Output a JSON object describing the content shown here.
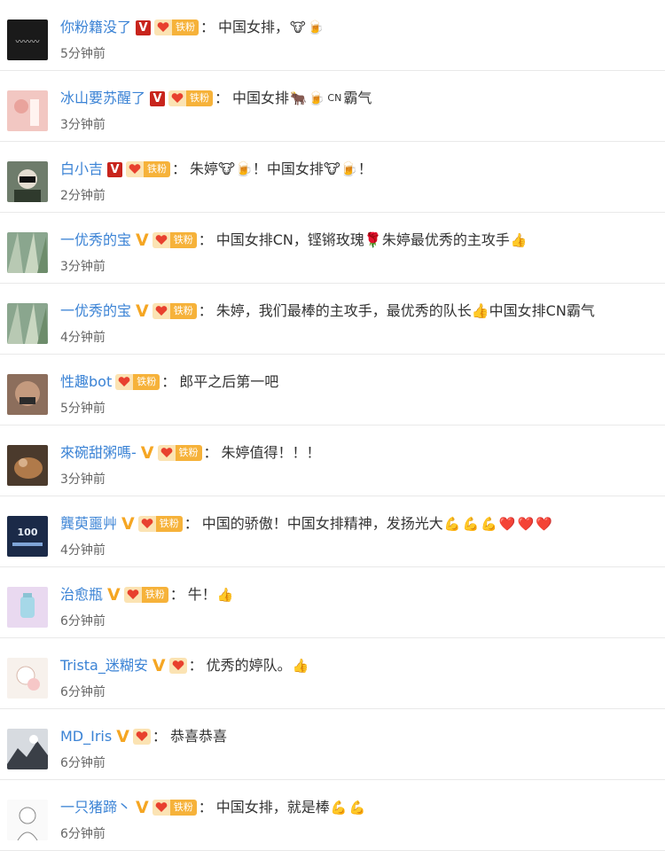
{
  "comments": [
    {
      "user": "你粉籍没了",
      "badge": "red",
      "fan": "铁粉",
      "text": "中国女排，",
      "emojis": [
        "🐮",
        "🍺"
      ],
      "time": "5分钟前"
    },
    {
      "user": "冰山要苏醒了",
      "badge": "red",
      "fan": "铁粉",
      "text": "中国女排",
      "emojis": [
        "🐂",
        "🍺"
      ],
      "suffix_small": "CN",
      "suffix": "霸气",
      "time": "3分钟前"
    },
    {
      "user": "白小吉",
      "badge": "red",
      "fan": "铁粉",
      "text": "朱婷🐮🍺！中国女排🐮🍺！",
      "emojis": [],
      "time": "2分钟前"
    },
    {
      "user": "一优秀的宝",
      "badge": "gold",
      "fan": "铁粉",
      "text": "中国女排CN，铿锵玫瑰🌹朱婷最优秀的主攻手",
      "emojis": [
        "👍"
      ],
      "time": "3分钟前"
    },
    {
      "user": "一优秀的宝",
      "badge": "gold",
      "fan": "铁粉",
      "text": "朱婷，我们最棒的主攻手，最优秀的队长👍中国女排CN霸气",
      "emojis": [],
      "time": "4分钟前"
    },
    {
      "user": "性趣bot",
      "badge": "",
      "fan": "铁粉",
      "text": "郎平之后第一吧",
      "emojis": [],
      "time": "5分钟前"
    },
    {
      "user": "來碗甜粥嗎-",
      "badge": "gold",
      "fan": "铁粉",
      "text": "朱婷值得！！！",
      "emojis": [],
      "time": "3分钟前"
    },
    {
      "user": "龔萸噩艸",
      "badge": "gold",
      "fan": "铁粉",
      "text": "中国的骄傲！中国女排精神，发扬光大",
      "emojis": [
        "💪",
        "💪",
        "💪",
        "❤️",
        "❤️",
        "❤️"
      ],
      "time": "4分钟前"
    },
    {
      "user": "治愈瓶",
      "badge": "gold",
      "fan": "铁粉",
      "text": "牛！",
      "emojis": [
        "👍"
      ],
      "time": "6分钟前"
    },
    {
      "user": "Trista_迷糊安",
      "badge": "gold",
      "fan": "",
      "text": "优秀的婷队。",
      "emojis": [
        "👍"
      ],
      "time": "6分钟前"
    },
    {
      "user": "MD_Iris",
      "badge": "gold",
      "fan": "",
      "text": "恭喜恭喜",
      "emojis": [],
      "time": "6分钟前"
    },
    {
      "user": "一只猪蹄丶",
      "badge": "gold",
      "fan": "铁粉",
      "text": "中国女排，就是棒",
      "emojis": [
        "💪",
        "💪"
      ],
      "time": "6分钟前"
    }
  ],
  "colors": {
    "link": "#3b83d5",
    "text": "#333333",
    "time": "#666666",
    "verified_red": "#c8241c",
    "verified_gold": "#f5a623",
    "fan_badge": "#f6b23a"
  }
}
